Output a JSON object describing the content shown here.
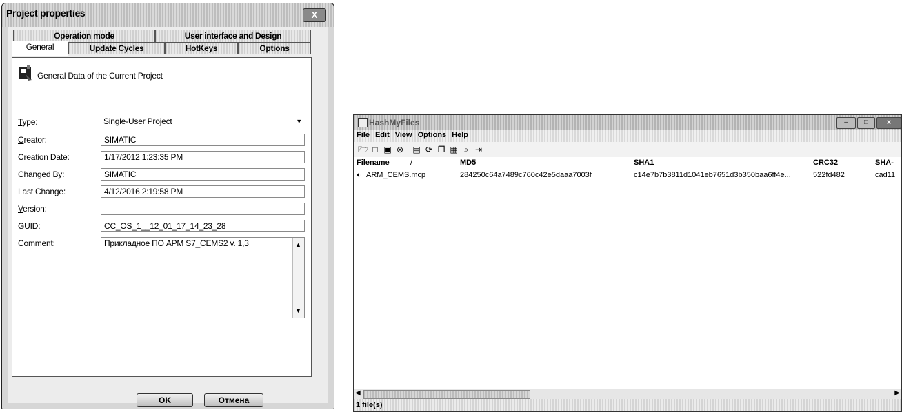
{
  "dialog": {
    "title": "Project properties",
    "close_label": "X",
    "tabs_back": [
      "Operation mode",
      "User interface and Design"
    ],
    "tabs_front": [
      "General",
      "Update Cycles",
      "HotKeys",
      "Options"
    ],
    "header_text": "General Data of the Current Project",
    "fields": [
      {
        "label_pre": "",
        "label_acc": "T",
        "label_post": "ype:",
        "value": "Single-User Project"
      },
      {
        "label_pre": "",
        "label_acc": "C",
        "label_post": "reator:",
        "value": "SIMATIC"
      },
      {
        "label_pre": "Creation ",
        "label_acc": "D",
        "label_post": "ate:",
        "value": "1/17/2012 1:23:35 PM"
      },
      {
        "label_pre": "Changed ",
        "label_acc": "B",
        "label_post": "y:",
        "value": "SIMATIC"
      },
      {
        "label_pre": "Last Chan",
        "label_acc": "g",
        "label_post": "e:",
        "value": "4/12/2016 2:19:58 PM"
      },
      {
        "label_pre": "",
        "label_acc": "V",
        "label_post": "ersion:",
        "value": ""
      },
      {
        "label_pre": "GUID:",
        "label_acc": "",
        "label_post": "",
        "value": "CC_OS_1__12_01_17_14_23_28"
      },
      {
        "label_pre": "Co",
        "label_acc": "m",
        "label_post": "ment:",
        "value": "Прикладное ПО АРМ S7_CEMS2 v. 1,3"
      }
    ],
    "ok_label": "OK",
    "cancel_label": "Отмена"
  },
  "hashmyfiles": {
    "title": "HashMyFiles",
    "menu": [
      "File",
      "Edit",
      "View",
      "Options",
      "Help"
    ],
    "toolbar_icons": [
      "open-folder-icon",
      "folder-icon",
      "drive-icon",
      "stop-icon",
      "save-icon",
      "refresh-icon",
      "copy-icon",
      "properties-icon",
      "find-icon",
      "exit-icon"
    ],
    "columns": [
      "Filename",
      "MD5",
      "SHA1",
      "CRC32",
      "SHA-"
    ],
    "rows": [
      {
        "filename": "ARM_CEMS.mcp",
        "md5": "284250c64a7489c760c42e5daaa7003f",
        "sha1": "c14e7b7b3811d1041eb7651d3b350baa6ff4e...",
        "crc32": "522fd482",
        "sha256": "cad11"
      }
    ],
    "status": "1 file(s)"
  }
}
